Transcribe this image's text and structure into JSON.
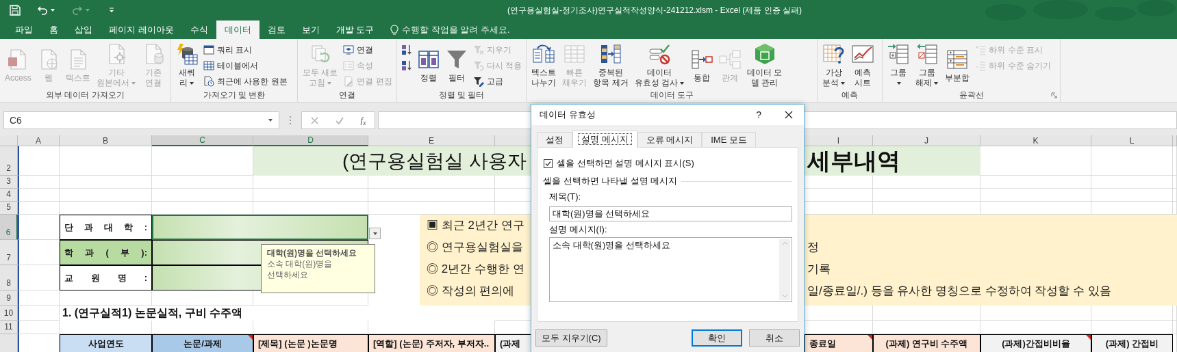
{
  "title_bar": {
    "title": "(연구용실험실-정기조사)연구실적작성양식-241212.xlsm - Excel (제품 인증 실패)",
    "quick_access": [
      {
        "kind": "save",
        "disabled": false
      },
      {
        "kind": "undo",
        "disabled": false
      },
      {
        "kind": "redo",
        "disabled": true
      }
    ]
  },
  "tabs": [
    {
      "label": "파일",
      "selected": false
    },
    {
      "label": "홈",
      "selected": false
    },
    {
      "label": "삽입",
      "selected": false
    },
    {
      "label": "페이지 레이아웃",
      "selected": false
    },
    {
      "label": "수식",
      "selected": false
    },
    {
      "label": "데이터",
      "selected": true
    },
    {
      "label": "검토",
      "selected": false
    },
    {
      "label": "보기",
      "selected": false
    },
    {
      "label": "개발 도구",
      "selected": false
    }
  ],
  "tell_me": "수행할 작업을 알려 주세요.",
  "ribbon": {
    "groups": [
      {
        "label": "외부 데이터 가져오기",
        "items": [
          {
            "kind": "large",
            "lines": [
              "Access"
            ],
            "disabled": true
          },
          {
            "kind": "large",
            "lines": [
              "웹"
            ],
            "disabled": true
          },
          {
            "kind": "large",
            "lines": [
              "텍스트"
            ],
            "disabled": true
          },
          {
            "kind": "large",
            "lines": [
              "기타",
              "원본에서"
            ],
            "disabled": true,
            "caret": true
          },
          {
            "kind": "large",
            "lines": [
              "기존",
              "연결"
            ],
            "disabled": true
          }
        ]
      },
      {
        "label": "가져오기 및 변환",
        "items": [
          {
            "kind": "large",
            "lines": [
              "새쿼",
              "리"
            ],
            "disabled": false,
            "caret": true
          },
          {
            "kind": "small",
            "lines": [
              "쿼리 표시"
            ],
            "disabled": false
          },
          {
            "kind": "small",
            "lines": [
              "테이블에서"
            ],
            "disabled": false
          },
          {
            "kind": "small",
            "lines": [
              "최근에 사용한 원본"
            ],
            "disabled": false
          }
        ]
      },
      {
        "label": "연결",
        "items": [
          {
            "kind": "large",
            "lines": [
              "모두 새로",
              "고침"
            ],
            "disabled": true,
            "caret": true
          },
          {
            "kind": "small",
            "lines": [
              "연결"
            ],
            "disabled": false
          },
          {
            "kind": "small",
            "lines": [
              "속성"
            ],
            "disabled": true
          },
          {
            "kind": "small",
            "lines": [
              "연결 편집"
            ],
            "disabled": true
          }
        ]
      },
      {
        "label": "정렬 및 필터",
        "items": [
          {
            "kind": "icon",
            "disabled": false
          },
          {
            "kind": "icon",
            "disabled": false
          },
          {
            "kind": "large",
            "lines": [
              "정렬"
            ],
            "disabled": false
          },
          {
            "kind": "large",
            "lines": [
              "필터"
            ],
            "disabled": false
          },
          {
            "kind": "small",
            "lines": [
              "지우기"
            ],
            "disabled": true
          },
          {
            "kind": "small",
            "lines": [
              "다시 적용"
            ],
            "disabled": true
          },
          {
            "kind": "small",
            "lines": [
              "고급"
            ],
            "disabled": false
          }
        ]
      },
      {
        "label": "데이터 도구",
        "items": [
          {
            "kind": "large",
            "lines": [
              "텍스트",
              "나누기"
            ],
            "disabled": false
          },
          {
            "kind": "large",
            "lines": [
              "빠른",
              "채우기"
            ],
            "disabled": true
          },
          {
            "kind": "large",
            "lines": [
              "중복된",
              "항목 제거"
            ],
            "disabled": false
          },
          {
            "kind": "large",
            "lines": [
              "데이터",
              "유효성 검사"
            ],
            "disabled": false,
            "caret": true
          },
          {
            "kind": "large",
            "lines": [
              "통합"
            ],
            "disabled": false
          },
          {
            "kind": "large",
            "lines": [
              "관계"
            ],
            "disabled": true
          },
          {
            "kind": "large",
            "lines": [
              "데이터 모",
              "델 관리"
            ],
            "disabled": false
          }
        ]
      },
      {
        "label": "예측",
        "items": [
          {
            "kind": "large",
            "lines": [
              "가상",
              "분석"
            ],
            "disabled": false,
            "caret": true
          },
          {
            "kind": "large",
            "lines": [
              "예측",
              "시트"
            ],
            "disabled": false
          }
        ]
      },
      {
        "label": "윤곽선",
        "items": [
          {
            "kind": "large",
            "lines": [
              "그룹"
            ],
            "disabled": false,
            "caret": true
          },
          {
            "kind": "large",
            "lines": [
              "그룹",
              "해제"
            ],
            "disabled": false,
            "caret": true
          },
          {
            "kind": "large",
            "lines": [
              "부분합"
            ],
            "disabled": false
          },
          {
            "kind": "small",
            "lines": [
              "하위 수준 표시"
            ],
            "disabled": true
          },
          {
            "kind": "small",
            "lines": [
              "하위 수준 숨기기"
            ],
            "disabled": true
          }
        ]
      }
    ]
  },
  "formula_bar": {
    "name_box": "C6",
    "function_label": "f$_{x}$"
  },
  "sheet": {
    "column_headers": [
      {
        "label": "A",
        "selected": false
      },
      {
        "label": "B",
        "selected": false
      },
      {
        "label": "C",
        "selected": true
      },
      {
        "label": "D",
        "selected": true
      },
      {
        "label": "E",
        "selected": false
      },
      {
        "label": "I",
        "selected": false
      },
      {
        "label": "J",
        "selected": false
      },
      {
        "label": "K",
        "selected": false
      },
      {
        "label": "L",
        "selected": false
      }
    ],
    "row_headers": [
      {
        "label": "2",
        "selected": false
      },
      {
        "label": "3",
        "selected": false
      },
      {
        "label": "4",
        "selected": false
      },
      {
        "label": "5",
        "selected": false
      },
      {
        "label": "6",
        "selected": true
      },
      {
        "label": "7",
        "selected": false
      },
      {
        "label": "8",
        "selected": false
      },
      {
        "label": "9",
        "selected": false
      },
      {
        "label": "10",
        "selected": false
      },
      {
        "label": "11",
        "selected": false
      }
    ],
    "banner": {
      "left": "(연구용실험실 사용자",
      "right": "세부내역"
    },
    "info_box": {
      "lines": [
        {
          "left": "▣ 최근 2년간 연구"
        },
        {
          "left": "◎ 연구용실험실을",
          "right": "정"
        },
        {
          "left": "◎ 2년간 수행한 연",
          "right": "기록"
        },
        {
          "left": "◎  작성의 편의에",
          "right": "일/종료일/.) 등을 유사한 명칭으로 수정하여 작성할 수 있음"
        }
      ]
    },
    "form": [
      {
        "label": "단 과 대 학 :",
        "color": "#ffffff",
        "selected": true
      },
      {
        "label": "학 과 ( 부 ):",
        "color": "#b7dba0",
        "selected": false
      },
      {
        "label": "교 원 명 :",
        "color": "#ffffff",
        "selected": false
      }
    ],
    "tooltip": {
      "title": "대학(원)명을 선택하세요",
      "lines": [
        "소속 대학(원)명을",
        "선택하세요"
      ]
    },
    "section_heading": "1. (연구실적1) 논문실적,  구비 수주액",
    "table_headers": [
      {
        "text": "사업연도",
        "color": "#c9def2",
        "comment": false
      },
      {
        "text": "논문/과제",
        "color": "#a9c9e8",
        "comment": true
      },
      {
        "text": "[제목] (논문 )논문명",
        "color": "#fce4d6",
        "comment": false
      },
      {
        "text": "[역할] (논문) 주저자, 부저자..",
        "color": "#fce4d6",
        "comment": false
      },
      {
        "text": "(과제",
        "color": "#f2f2f2",
        "comment": false
      },
      {
        "text": "종료일",
        "color": "#fce4d6",
        "comment": true
      },
      {
        "text": "(과제) 연구비 수주액",
        "color": "#fce4d6",
        "comment": false
      },
      {
        "text": "(과제)간접비비율",
        "color": "#f2f2f2",
        "comment": true
      },
      {
        "text": "(과제) 간접비",
        "color": "#f2f2f2",
        "comment": false
      }
    ]
  },
  "dialog": {
    "title": "데이터 유효성",
    "help": "?",
    "tabs": [
      {
        "label": "설정",
        "selected": false
      },
      {
        "label": "설명 메시지",
        "selected": true
      },
      {
        "label": "오류 메시지",
        "selected": false
      },
      {
        "label": "IME 모드",
        "selected": false
      }
    ],
    "show_message": {
      "label": "셀을 선택하면 설명 메시지 표시(S)",
      "checked": true
    },
    "group_label": "셀을 선택하면 나타낼 설명 메시지",
    "title_label": "제목(T):",
    "title_value": "대학(원)명을 선택하세요",
    "message_label": "설명 메시지(I):",
    "message_value": "소속 대학(원)명을 선택하세요",
    "buttons": [
      {
        "label": "모두 지우기(C)",
        "focused": false
      },
      {
        "label": "확인",
        "focused": true
      },
      {
        "label": "취소",
        "focused": false
      }
    ]
  }
}
